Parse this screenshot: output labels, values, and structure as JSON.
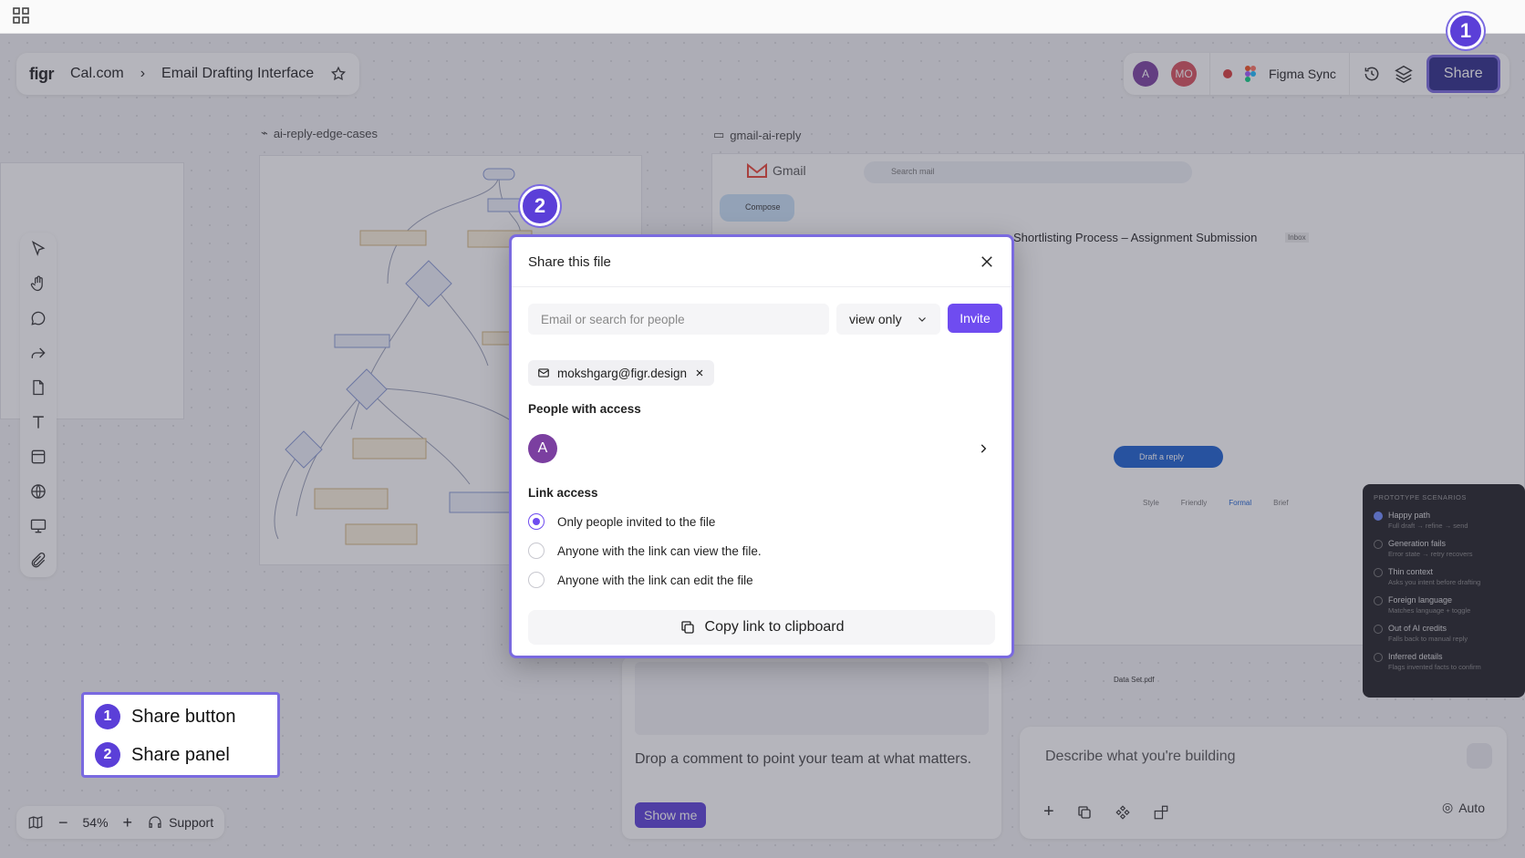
{
  "app": {
    "logo": "figr",
    "breadcrumb": [
      "Cal.com",
      "Email Drafting Interface"
    ]
  },
  "toolbar": {
    "avatars": [
      {
        "initials": "A",
        "color": "#7b3fa0"
      },
      {
        "initials": "MO",
        "color": "#d94f5c"
      }
    ],
    "sync_label": "Figma Sync",
    "share_label": "Share"
  },
  "frames": {
    "left_label": "ai-reply-edge-cases",
    "right_label": "gmail-ai-reply"
  },
  "gmail": {
    "brand": "Gmail",
    "search_placeholder": "Search mail",
    "compose": "Compose",
    "subject": "Shortlisting Process – Assignment Submission",
    "inbox_tag": "Inbox",
    "draft_button": "Draft a reply",
    "tones": [
      "Style",
      "Friendly",
      "Formal",
      "Brief"
    ],
    "attachment": "Data Set.pdf"
  },
  "scenarios": {
    "title": "PROTOTYPE SCENARIOS",
    "items": [
      {
        "name": "Happy path",
        "desc": "Full draft → refine → send",
        "active": true
      },
      {
        "name": "Generation fails",
        "desc": "Error state → retry recovers",
        "active": false
      },
      {
        "name": "Thin context",
        "desc": "Asks you intent before drafting",
        "active": false
      },
      {
        "name": "Foreign language",
        "desc": "Matches language + toggle",
        "active": false
      },
      {
        "name": "Out of AI credits",
        "desc": "Falls back to manual reply",
        "active": false
      },
      {
        "name": "Inferred details",
        "desc": "Flags invented facts to confirm",
        "active": false
      }
    ]
  },
  "modal": {
    "title": "Share this file",
    "email_placeholder": "Email or search for people",
    "permission": "view only",
    "invite_label": "Invite",
    "chip_email": "mokshgarg@figr.design",
    "people_heading": "People with access",
    "person_initial": "A",
    "link_heading": "Link access",
    "link_options": [
      {
        "label": "Only people invited to the file",
        "selected": true
      },
      {
        "label": "Anyone with the link can view the file.",
        "selected": false
      },
      {
        "label": "Anyone with the link can edit the file",
        "selected": false
      }
    ],
    "copy_label": "Copy link to clipboard"
  },
  "callouts": {
    "badge1": "1",
    "badge2": "2",
    "legend": [
      {
        "num": "1",
        "label": "Share button"
      },
      {
        "num": "2",
        "label": "Share panel"
      }
    ]
  },
  "comment": {
    "text": "Drop a comment to point your team at what matters.",
    "button": "Show me"
  },
  "build": {
    "placeholder": "Describe what you're building",
    "mode": "Auto"
  },
  "bottom_bar": {
    "zoom": "54%",
    "support": "Support"
  }
}
